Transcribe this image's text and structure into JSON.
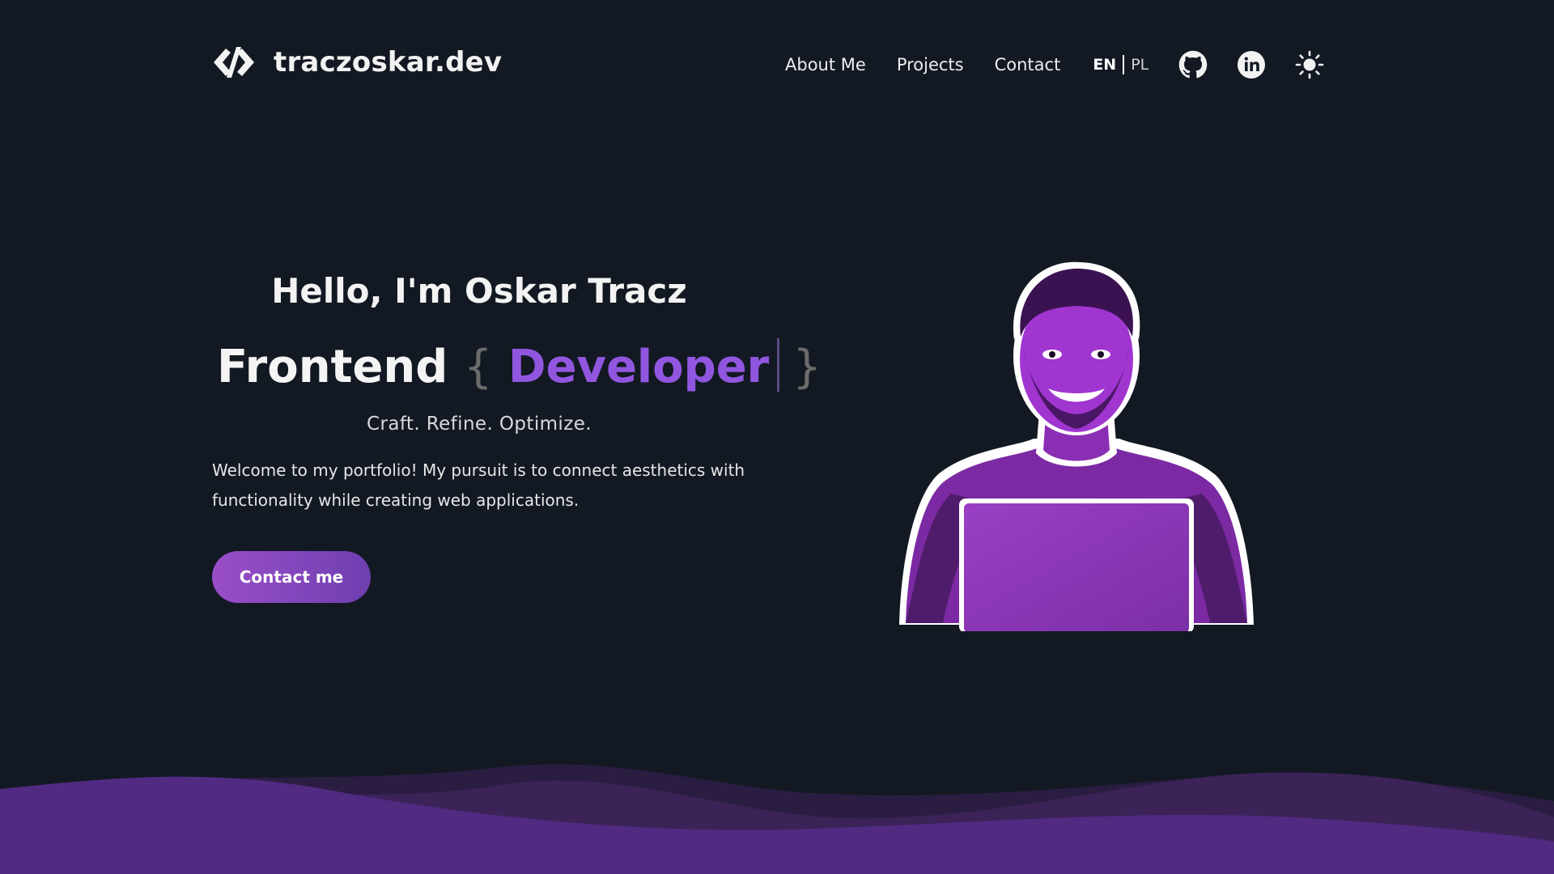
{
  "header": {
    "site_name": "traczoskar.dev",
    "nav": {
      "about": "About Me",
      "projects": "Projects",
      "contact": "Contact"
    },
    "language": {
      "active": "EN",
      "other": "PL"
    },
    "icons": [
      "code-logo-icon",
      "github-icon",
      "linkedin-icon",
      "sun-icon"
    ]
  },
  "hero": {
    "greeting_prefix": "Hello, I'm ",
    "name": "Oskar Tracz",
    "role_main": "Frontend",
    "brace_open": "{",
    "role_highlight": "Developer",
    "brace_close": "}",
    "tagline": "Craft. Refine. Optimize.",
    "intro": "Welcome to my portfolio! My pursuit is to connect aesthetics with functionality while creating web applications.",
    "cta": "Contact me"
  },
  "colors": {
    "background": "#131923",
    "accent": "#9156e0",
    "button_start": "#9a4ec8",
    "button_end": "#6e3fb0",
    "wave_front": "#512a82",
    "wave_back": "#3b2358"
  }
}
